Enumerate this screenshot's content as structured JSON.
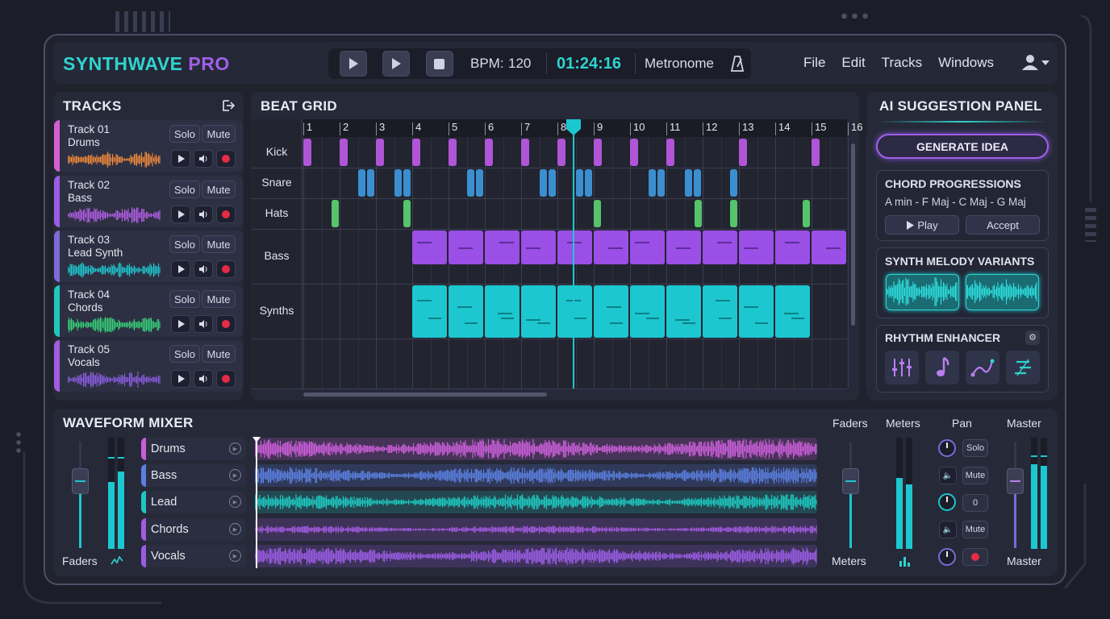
{
  "app": {
    "name_part1": "SYNTHWAVE",
    "name_part2": "PRO"
  },
  "transport": {
    "bpm_label": "BPM:",
    "bpm_value": "120",
    "time": "01:24:16",
    "metronome_label": "Metronome"
  },
  "menu": [
    "File",
    "Edit",
    "Tracks",
    "Windows"
  ],
  "tracks_panel": {
    "title": "TRACKS",
    "solo_label": "Solo",
    "mute_label": "Mute",
    "items": [
      {
        "number": "Track 01",
        "name": "Drums",
        "color": "#d45fd0",
        "wave_color": "#f08a3c"
      },
      {
        "number": "Track 02",
        "name": "Bass",
        "color": "#9b5de5",
        "wave_color": "#b15ee6"
      },
      {
        "number": "Track 03",
        "name": "Lead Synth",
        "color": "#7e6bd6",
        "wave_color": "#1ec8d0"
      },
      {
        "number": "Track 04",
        "name": "Chords",
        "color": "#1fc8bd",
        "wave_color": "#35d27a"
      },
      {
        "number": "Track 05",
        "name": "Vocals",
        "color": "#a35be0",
        "wave_color": "#8a5ce0"
      }
    ]
  },
  "beat_grid": {
    "title": "BEAT GRID",
    "bars": [
      "1",
      "2",
      "3",
      "4",
      "5",
      "6",
      "7",
      "8",
      "9",
      "10",
      "11",
      "12",
      "13",
      "14",
      "15",
      "16"
    ],
    "rows": [
      "Kick",
      "Snare",
      "Hats",
      "Bass",
      "Synths"
    ],
    "colors": {
      "kick": "#b055d8",
      "snare": "#3b8fd0",
      "hats": "#55c46a",
      "bass": "#9a4fe6",
      "synths": "#1cc7cf",
      "playhead": "#1cc7cf"
    }
  },
  "ai_panel": {
    "title": "AI SUGGESTION PANEL",
    "generate_label": "GENERATE IDEA",
    "chords": {
      "title": "CHORD PROGRESSIONS",
      "progression": "A min - F Maj - C Maj - G Maj",
      "play_label": "Play",
      "accept_label": "Accept"
    },
    "melody": {
      "title": "SYNTH MELODY VARIANTS"
    },
    "rhythm": {
      "title": "RHYTHM ENHANCER"
    }
  },
  "mixer": {
    "title": "WAVEFORM MIXER",
    "faders_label": "Faders",
    "meters_label": "Meters",
    "pan_label": "Pan",
    "master_label": "Master",
    "solo_label": "Solo",
    "mute_label": "Mute",
    "pan_value": "0",
    "channels": [
      {
        "name": "Drums",
        "color": "#c95ed8"
      },
      {
        "name": "Bass",
        "color": "#5a7fe0"
      },
      {
        "name": "Lead",
        "color": "#1ec8c0"
      },
      {
        "name": "Chords",
        "color": "#a35be0"
      },
      {
        "name": "Vocals",
        "color": "#9a5ce4"
      }
    ]
  }
}
